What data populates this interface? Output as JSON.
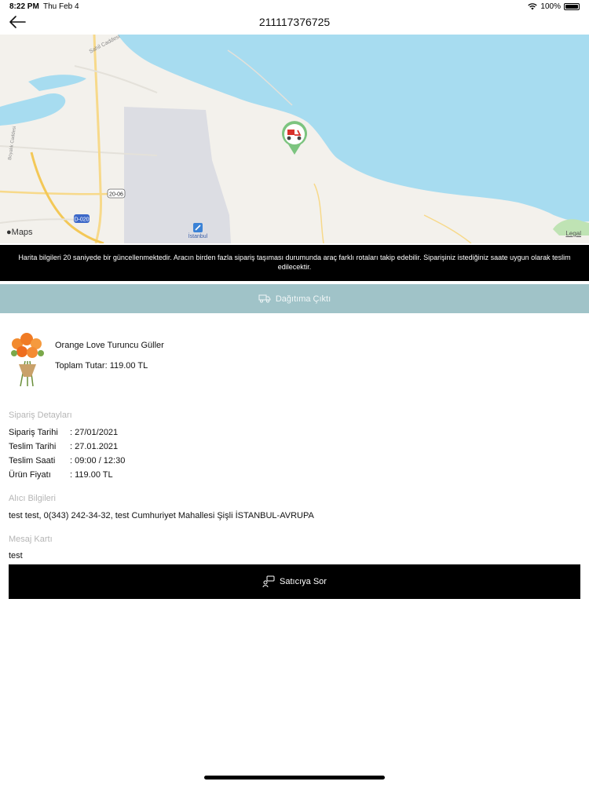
{
  "status_bar": {
    "time": "8:22 PM",
    "date": "Thu Feb 4",
    "battery": "100%"
  },
  "header": {
    "title": "211117376725"
  },
  "map": {
    "brand": "Maps",
    "legal": "Legal",
    "labels": {
      "road_sahil": "Sahil Caddesi",
      "road_boyalik": "Boyalık Caddesi",
      "shield_20_06": "20-06",
      "shield_d020": "D-020",
      "airport": "İstanbul"
    },
    "colors": {
      "water": "#a7dcf0",
      "land": "#f3f1ec",
      "airport_zone": "#dcdde3",
      "road": "#f7d98a",
      "park": "#bfe3b4"
    }
  },
  "info_text": "Harita bilgileri 20 saniyede bir güncellenmektedir. Aracın birden fazla sipariş taşıması durumunda araç farklı rotaları takip edebilir. Siparişiniz istediğiniz saate uygun olarak teslim edilecektir.",
  "delivery_status": {
    "label": "Dağıtıma Çıktı",
    "icon": "truck-icon",
    "color": "#a0c3c8"
  },
  "product": {
    "name": "Orange Love Turuncu Güller",
    "total": "Toplam Tutar: 119.00 TL"
  },
  "order_details": {
    "title": "Sipariş Detayları",
    "rows": [
      {
        "label": "Sipariş Tarihi",
        "value": ": 27/01/2021"
      },
      {
        "label": "Teslim Tarihi",
        "value": ": 27.01.2021"
      },
      {
        "label": "Teslim Saati",
        "value": ": 09:00 / 12:30"
      },
      {
        "label": "Ürün Fiyatı",
        "value": ": 119.00 TL"
      }
    ]
  },
  "recipient": {
    "title": "Alıcı Bilgileri",
    "text": "test test, 0(343) 242-34-32, test Cumhuriyet Mahallesi  Şişli  İSTANBUL-AVRUPA"
  },
  "message_card": {
    "title": "Mesaj Kartı",
    "text": "test"
  },
  "ask_seller": {
    "label": "Satıcıya Sor",
    "icon": "chat-person-icon"
  }
}
